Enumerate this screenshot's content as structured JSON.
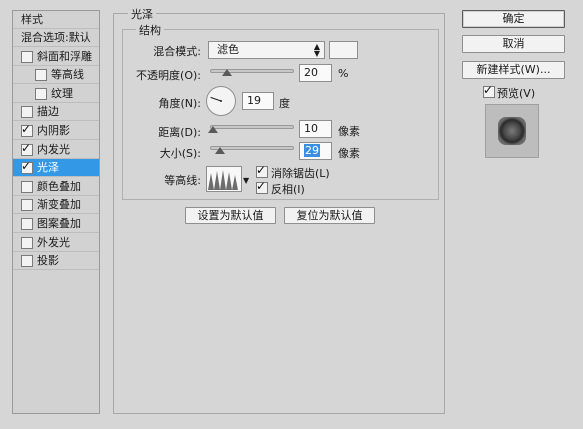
{
  "sidebar": {
    "header": "样式",
    "items": [
      {
        "label": "混合选项:默认",
        "checkbox": false,
        "checked": false,
        "selected": false,
        "indent": false
      },
      {
        "label": "斜面和浮雕",
        "checkbox": true,
        "checked": false,
        "selected": false,
        "indent": false
      },
      {
        "label": "等高线",
        "checkbox": true,
        "checked": false,
        "selected": false,
        "indent": true
      },
      {
        "label": "纹理",
        "checkbox": true,
        "checked": false,
        "selected": false,
        "indent": true
      },
      {
        "label": "描边",
        "checkbox": true,
        "checked": false,
        "selected": false,
        "indent": false
      },
      {
        "label": "内阴影",
        "checkbox": true,
        "checked": true,
        "selected": false,
        "indent": false
      },
      {
        "label": "内发光",
        "checkbox": true,
        "checked": true,
        "selected": false,
        "indent": false
      },
      {
        "label": "光泽",
        "checkbox": true,
        "checked": true,
        "selected": true,
        "indent": false
      },
      {
        "label": "颜色叠加",
        "checkbox": true,
        "checked": false,
        "selected": false,
        "indent": false
      },
      {
        "label": "渐变叠加",
        "checkbox": true,
        "checked": false,
        "selected": false,
        "indent": false
      },
      {
        "label": "图案叠加",
        "checkbox": true,
        "checked": false,
        "selected": false,
        "indent": false
      },
      {
        "label": "外发光",
        "checkbox": true,
        "checked": false,
        "selected": false,
        "indent": false
      },
      {
        "label": "投影",
        "checkbox": true,
        "checked": false,
        "selected": false,
        "indent": false
      }
    ]
  },
  "satin": {
    "title": "光泽",
    "structure_title": "结构",
    "blend_mode_label": "混合模式:",
    "blend_mode_value": "滤色",
    "opacity_label": "不透明度(O):",
    "opacity_value": "20",
    "opacity_unit": "%",
    "opacity_level": 0.2,
    "angle_label": "角度(N):",
    "angle_value": "19",
    "angle_unit": "度",
    "distance_label": "距离(D):",
    "distance_value": "10",
    "distance_unit": "像素",
    "distance_level": 0.04,
    "size_label": "大小(S):",
    "size_value": "29",
    "size_unit": "像素",
    "size_level": 0.12,
    "contour_label": "等高线:",
    "anti_alias_label": "消除锯齿(L)",
    "anti_alias_checked": true,
    "invert_label": "反相(I)",
    "invert_checked": true,
    "set_default_button": "设置为默认值",
    "reset_default_button": "复位为默认值"
  },
  "actions": {
    "ok": "确定",
    "cancel": "取消",
    "new_style": "新建样式(W)...",
    "preview_label": "预览(V)",
    "preview_checked": true
  },
  "icons": {
    "check": "checkmark-icon",
    "angle_dial": "angle-dial-icon",
    "contour_curve": "contour-curve-icon",
    "dropdown": "chevron-updown-icon",
    "preview": "style-preview-thumbnail"
  },
  "colors": {
    "dialog_bg": "#d6d6d6",
    "selection": "#3399e6",
    "field_highlight": "#3b8ee0"
  }
}
